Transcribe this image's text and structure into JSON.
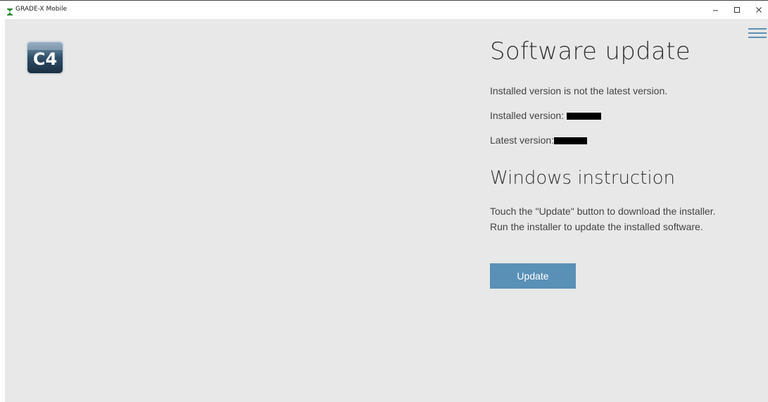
{
  "window": {
    "title": "GRADE-X Mobile",
    "controls": [
      "minimize-icon",
      "maximize-icon",
      "close-icon"
    ]
  },
  "logo": {
    "text": "C4",
    "icon": "c4-logo-icon"
  },
  "menu": {
    "icon": "hamburger-menu-icon"
  },
  "update": {
    "heading": "Software update",
    "status": "Installed version is not the latest version.",
    "installed_label": "Installed version: ",
    "installed_value_redacted": true,
    "latest_label": "Latest version:",
    "latest_value_redacted": true
  },
  "instructions": {
    "heading": "Windows instruction",
    "line1": "Touch the \"Update\" button to download the installer.",
    "line2": "Run the installer to update the installed software."
  },
  "actions": {
    "update_label": "Update"
  },
  "colors": {
    "background": "#e7e8e7",
    "accent": "#5a90b6",
    "text": "#444444"
  }
}
